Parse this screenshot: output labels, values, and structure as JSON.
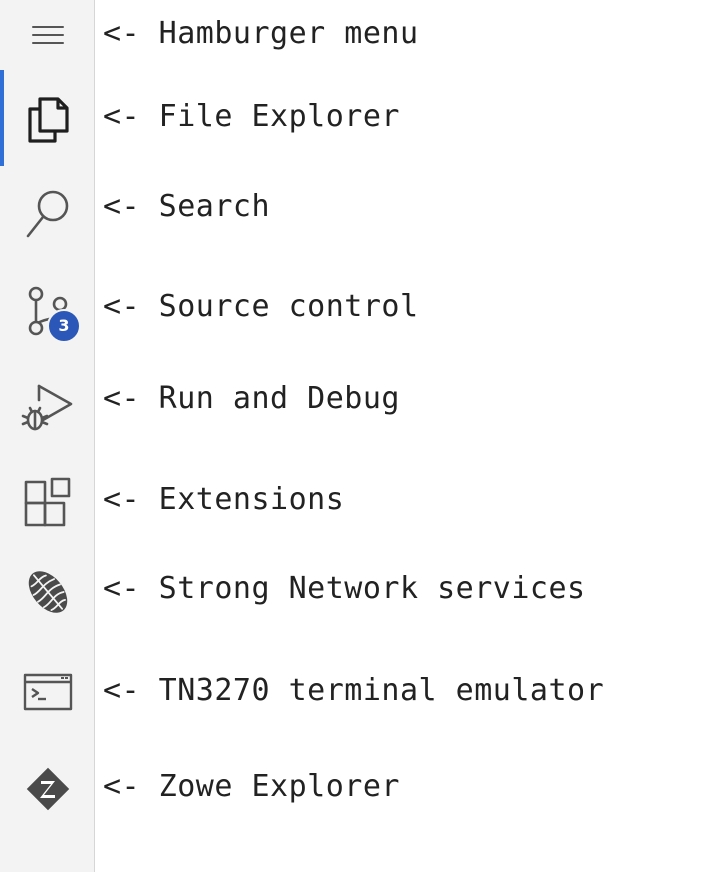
{
  "activity_bar": {
    "items": [
      {
        "id": "hamburger",
        "icon": "hamburger-menu-icon",
        "annotation": "<- Hamburger menu"
      },
      {
        "id": "explorer",
        "icon": "file-explorer-icon",
        "annotation": "<- File Explorer",
        "active": true
      },
      {
        "id": "search",
        "icon": "search-icon",
        "annotation": "<- Search"
      },
      {
        "id": "source-control",
        "icon": "source-control-icon",
        "annotation": "<- Source control",
        "badge": "3"
      },
      {
        "id": "run-debug",
        "icon": "run-debug-icon",
        "annotation": "<- Run and Debug"
      },
      {
        "id": "extensions",
        "icon": "extensions-icon",
        "annotation": "<- Extensions"
      },
      {
        "id": "strong-network",
        "icon": "strong-network-icon",
        "annotation": "<- Strong Network services"
      },
      {
        "id": "tn3270",
        "icon": "terminal-icon",
        "annotation": "<- TN3270 terminal emulator"
      },
      {
        "id": "zowe",
        "icon": "zowe-icon",
        "annotation": "<- Zowe Explorer"
      }
    ]
  },
  "colors": {
    "activity_bar_bg": "#f3f3f3",
    "active_indicator": "#2f6fd6",
    "badge_bg": "#2b57b8",
    "icon": "#444444"
  }
}
